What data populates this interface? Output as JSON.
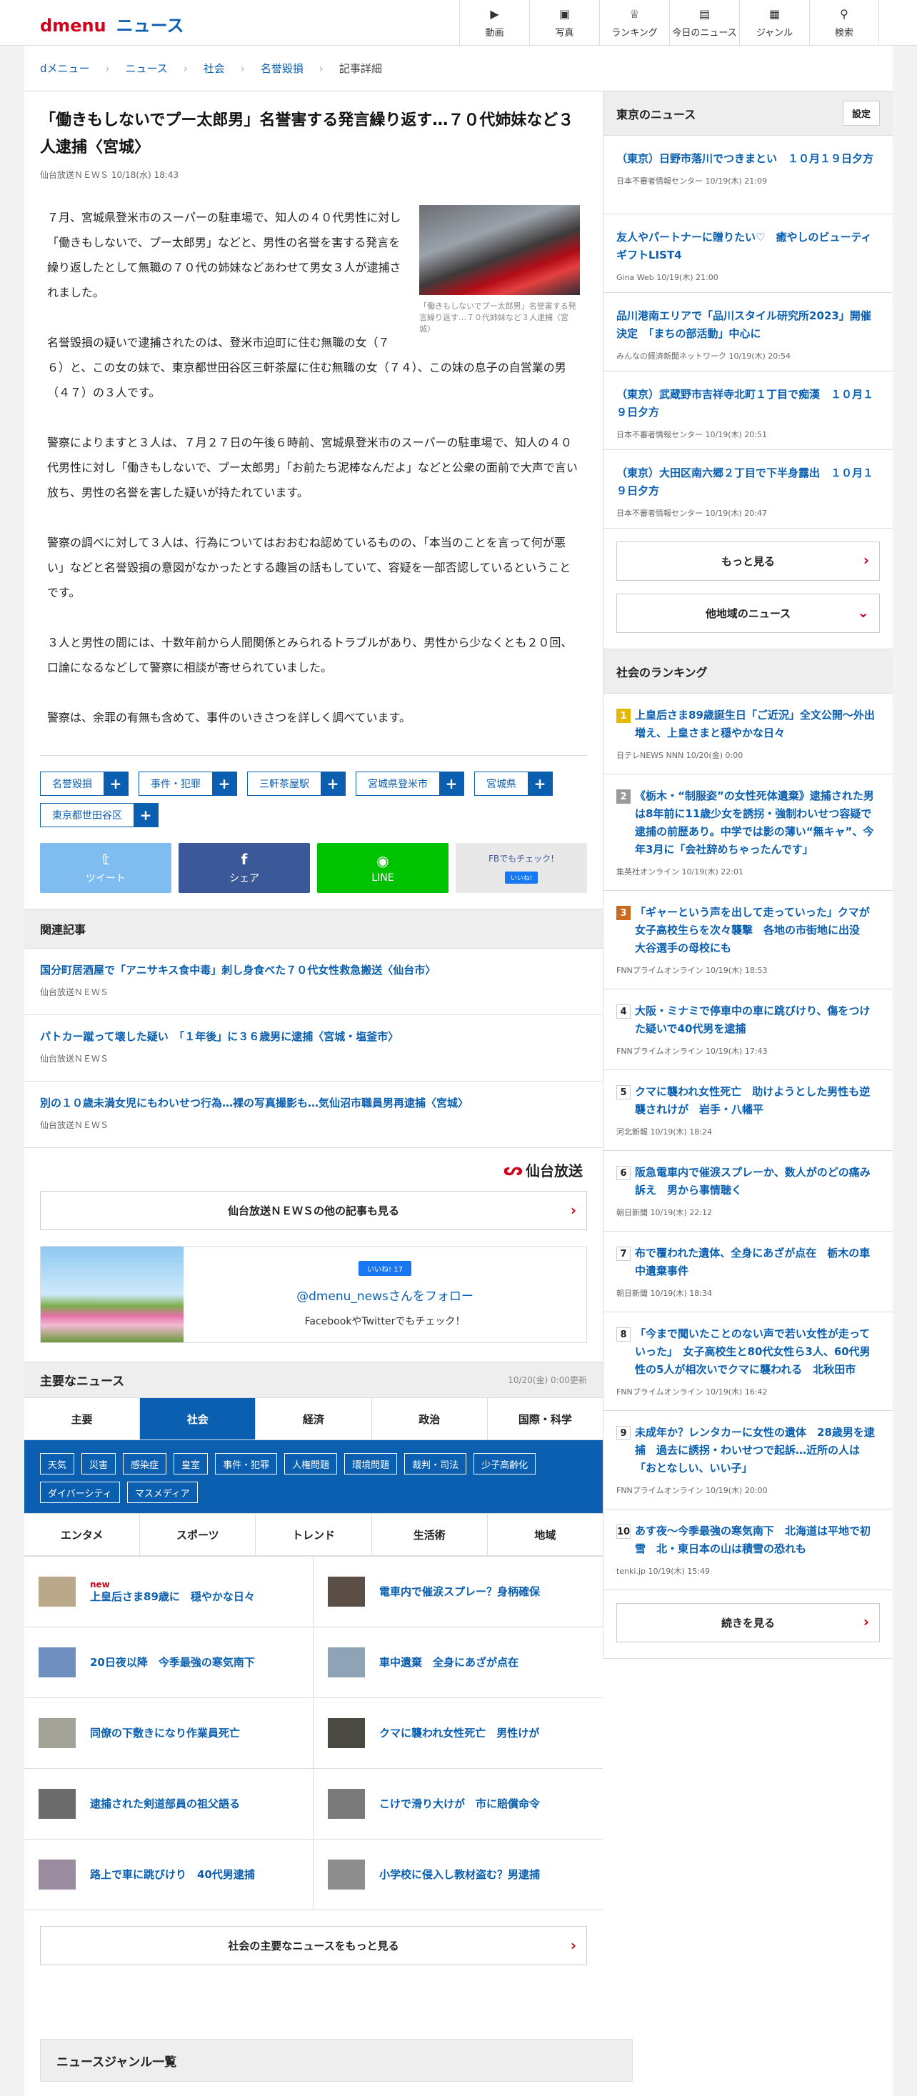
{
  "header": {
    "logo_d": "dmenu",
    "logo_news": "ニュース",
    "nav": [
      {
        "label": "動画",
        "icon": "video-icon"
      },
      {
        "label": "写真",
        "icon": "photo-icon"
      },
      {
        "label": "ランキング",
        "icon": "ranking-icon"
      },
      {
        "label": "今日のニュース",
        "icon": "today-icon"
      },
      {
        "label": "ジャンル",
        "icon": "genre-icon"
      },
      {
        "label": "検索",
        "icon": "search-icon"
      }
    ]
  },
  "breadcrumb": [
    "dメニュー",
    "ニュース",
    "社会",
    "名誉毀損",
    "記事詳細"
  ],
  "article": {
    "title": "「働きもしないでプー太郎男」名誉害する発言繰り返す…７０代姉妹など３人逮捕〈宮城〉",
    "source": "仙台放送ＮＥＷＳ",
    "date": "10/18(水) 18:43",
    "photo_caption": "「働きもしないでプー太郎男」名誉害する発言繰り返す…７０代姉妹など３人逮捕〈宮城〉",
    "paragraphs": [
      "７月、宮城県登米市のスーパーの駐車場で、知人の４０代男性に対し「働きもしないで、プー太郎男」などと、男性の名誉を害する発言を繰り返したとして無職の７０代の姉妹などあわせて男女３人が逮捕されました。",
      "名誉毀損の疑いで逮捕されたのは、登米市迫町に住む無職の女（７６）と、この女の妹で、東京都世田谷区三軒茶屋に住む無職の女（７４）、この妹の息子の自営業の男（４７）の３人です。",
      "警察によりますと３人は、７月２７日の午後６時前、宮城県登米市のスーパーの駐車場で、知人の４０代男性に対し「働きもしないで、プー太郎男」「お前たち泥棒なんだよ」などと公衆の面前で大声で言い放ち、男性の名誉を害した疑いが持たれています。",
      "警察の調べに対して３人は、行為についてはおおむね認めているものの、「本当のことを言って何が悪い」などと名誉毀損の意図がなかったとする趣旨の話もしていて、容疑を一部否認しているということです。",
      "３人と男性の間には、十数年前から人間関係とみられるトラブルがあり、男性から少なくとも２０回、口論になるなどして警察に相談が寄せられていました。",
      "警察は、余罪の有無も含めて、事件のいきさつを詳しく調べています。"
    ],
    "tags": [
      "名誉毀損",
      "事件・犯罪",
      "三軒茶屋駅",
      "宮城県登米市",
      "宮城県",
      "東京都世田谷区"
    ],
    "tag_plus": "+",
    "share": {
      "tweet": "ツイート",
      "share": "シェア",
      "line": "LINE",
      "fb_check": "FBでもチェック!",
      "fb_like": "いいね!"
    }
  },
  "related": {
    "heading": "関連記事",
    "items": [
      {
        "title": "国分町居酒屋で「アニサキス食中毒」刺し身食べた７０代女性救急搬送〈仙台市〉",
        "source": "仙台放送ＮＥＷＳ"
      },
      {
        "title": "パトカー蹴って壊した疑い　「１年後」に３６歳男に逮捕〈宮城・塩釜市〉",
        "source": "仙台放送ＮＥＷＳ"
      },
      {
        "title": "別の１０歳未満女児にもわいせつ行為…裸の写真撮影も…気仙沼市職員男再逮捕〈宮城〉",
        "source": "仙台放送ＮＥＷＳ"
      }
    ],
    "source_logo": "仙台放送",
    "more_button": "仙台放送ＮＥＷＳの他の記事も見る"
  },
  "follow": {
    "like_badge": "いいね! 17",
    "handle": "@dmenu_newsさんをフォロー",
    "sub": "FacebookやTwitterでもチェック！"
  },
  "topics": {
    "heading": "主要なニュース",
    "updated": "10/20(金) 0:00更新",
    "tabs_row1": [
      "主要",
      "社会",
      "経済",
      "政治",
      "国際・科学"
    ],
    "active_tab": "社会",
    "chips": [
      "天気",
      "災害",
      "感染症",
      "皇室",
      "事件・犯罪",
      "人権問題",
      "環境問題",
      "裁判・司法",
      "少子高齢化",
      "ダイバーシティ",
      "マスメディア"
    ],
    "tabs_row2": [
      "エンタメ",
      "スポーツ",
      "トレンド",
      "生活術",
      "地域"
    ],
    "items": [
      {
        "title": "上皇后さま89歳に　穏やかな日々",
        "new": "new"
      },
      {
        "title": "電車内で催涙スプレー？身柄確保",
        "new": ""
      },
      {
        "title": "20日夜以降　今季最強の寒気南下",
        "new": ""
      },
      {
        "title": "車中遺棄　全身にあざが点在",
        "new": ""
      },
      {
        "title": "同僚の下敷きになり作業員死亡",
        "new": ""
      },
      {
        "title": "クマに襲われ女性死亡　男性けが",
        "new": ""
      },
      {
        "title": "逮捕された剣道部員の祖父語る",
        "new": ""
      },
      {
        "title": "こけで滑り大けが　市に賠償命令",
        "new": ""
      },
      {
        "title": "路上で車に跳びけり　40代男逮捕",
        "new": ""
      },
      {
        "title": "小学校に侵入し教材盗む？男逮捕",
        "new": ""
      }
    ],
    "more_button": "社会の主要なニュースをもっと見る"
  },
  "genre_list_heading": "ニュースジャンル一覧",
  "sidebar": {
    "local": {
      "heading": "東京のニュース",
      "settings": "設定",
      "items": [
        {
          "title": "（東京）日野市落川でつきまとい　１０月１９日夕方",
          "meta": "日本不審者情報センター 10/19(木) 21:09"
        },
        {
          "title": "友人やパートナーに贈りたい♡　癒やしのビューティギフトLIST4",
          "meta": "Gina Web 10/19(木) 21:00"
        },
        {
          "title": "品川港南エリアで「品川スタイル研究所2023」開催決定　「まちの部活動」中心に",
          "meta": "みんなの経済新聞ネットワーク 10/19(木) 20:54"
        },
        {
          "title": "（東京）武蔵野市吉祥寺北町１丁目で痴漢　１０月１９日夕方",
          "meta": "日本不審者情報センター 10/19(木) 20:51"
        },
        {
          "title": "（東京）大田区南六郷２丁目で下半身露出　１０月１９日夕方",
          "meta": "日本不審者情報センター 10/19(木) 20:47"
        }
      ],
      "more": "もっと見る",
      "other_region": "他地域のニュース"
    },
    "ranking": {
      "heading": "社会のランキング",
      "items": [
        {
          "rank": "1",
          "title": "上皇后さま89歳誕生日「ご近況」全文公開〜外出増え、上皇さまと穏やかな日々",
          "meta": "日テレNEWS NNN 10/20(金) 0:00"
        },
        {
          "rank": "2",
          "title": "《栃木・“制服姿”の女性死体遺棄》逮捕された男は8年前に11歳少女を誘拐・強制わいせつ容疑で逮捕の前歴あり。中学では影の薄い“無キャ”、今年3月に「会社辞めちゃったんです」",
          "meta": "集英社オンライン 10/19(木) 22:01"
        },
        {
          "rank": "3",
          "title": "「ギャーという声を出して走っていった」クマが女子高校生らを次々襲撃　各地の市街地に出没　大谷選手の母校にも",
          "meta": "FNNプライムオンライン 10/19(木) 18:53"
        },
        {
          "rank": "4",
          "title": "大阪・ミナミで停車中の車に跳びけり、傷をつけた疑いで40代男を逮捕",
          "meta": "FNNプライムオンライン 10/19(木) 17:43"
        },
        {
          "rank": "5",
          "title": "クマに襲われ女性死亡　助けようとした男性も逆襲されけが　岩手・八幡平",
          "meta": "河北新報 10/19(木) 18:24"
        },
        {
          "rank": "6",
          "title": "阪急電車内で催涙スプレーか、数人がのどの痛み訴え　男から事情聴く",
          "meta": "朝日新聞 10/19(木) 22:12"
        },
        {
          "rank": "7",
          "title": "布で覆われた遺体、全身にあざが点在　栃木の車中遺棄事件",
          "meta": "朝日新聞 10/19(木) 18:34"
        },
        {
          "rank": "8",
          "title": "「今まで聞いたことのない声で若い女性が走っていった」　女子高校生と80代女性ら3人、60代男性の5人が相次いでクマに襲われる　北秋田市",
          "meta": "FNNプライムオンライン 10/19(木) 16:42"
        },
        {
          "rank": "9",
          "title": "未成年か？レンタカーに女性の遺体　28歳男を逮捕　過去に誘拐・わいせつで起訴…近所の人は「おとなしい、いい子」",
          "meta": "FNNプライムオンライン 10/19(木) 20:00"
        },
        {
          "rank": "10",
          "title": "あす夜〜今季最強の寒気南下　北海道は平地で初雪　北・東日本の山は積雪の恐れも",
          "meta": "tenki.jp 10/19(木) 15:49"
        }
      ],
      "more": "続きを見る"
    }
  }
}
